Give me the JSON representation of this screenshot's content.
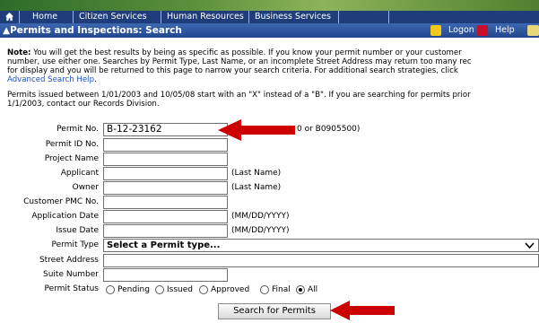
{
  "nav": {
    "items": [
      {
        "label": "Home"
      },
      {
        "label": "Citizen Services"
      },
      {
        "label": "Human Resources"
      },
      {
        "label": "Business Services"
      }
    ]
  },
  "titlebar": {
    "title": "▲Permits and Inspections: Search",
    "logon": "Logon",
    "help": "Help"
  },
  "note": {
    "bold": "Note:",
    "line1": " You will get the best results by being as specific as possible. If you know your permit number or your customer",
    "line2": "number, use either one. Searches by Permit Type, Last Name, or an incomplete Street Address may return too many rec",
    "line3": "for display and you will be returned to this page to narrow your search criteria. For additional search strategies, click",
    "link": "Advanced Search Help",
    "link_tail": "."
  },
  "permits_info": {
    "line1": "Permits issued between 1/01/2003 and 10/05/08 start with an \"X\" instead of a \"B\". If you are searching for permits prior",
    "line2": "1/1/2003, contact our Records Division."
  },
  "form": {
    "permit_no_label": "Permit No.",
    "permit_no_value": "B-12-23162",
    "permit_no_hint_start": "(e",
    "permit_no_hint_end": "0 or B0905500)",
    "permit_id_label": "Permit ID No.",
    "project_name_label": "Project Name",
    "applicant_label": "Applicant",
    "applicant_hint": "(Last Name)",
    "owner_label": "Owner",
    "owner_hint": "(Last Name)",
    "customer_pmc_label": "Customer PMC No.",
    "application_date_label": "Application Date",
    "application_date_hint": "(MM/DD/YYYY)",
    "issue_date_label": "Issue Date",
    "issue_date_hint": "(MM/DD/YYYY)",
    "permit_type_label": "Permit Type",
    "permit_type_value": "Select a Permit type...",
    "street_address_label": "Street Address",
    "suite_number_label": "Suite Number",
    "permit_status_label": "Permit Status",
    "status_options": [
      "Pending",
      "Issued",
      "Approved",
      "Final",
      "All"
    ],
    "selected_status": "All",
    "submit_label": "Search for Permits"
  },
  "colors": {
    "nav_bg": "#1f3d7a",
    "title_bg": "#2d559e",
    "arrow": "#cc0000",
    "link": "#1a4fc6"
  },
  "icons": [
    "home-icon",
    "lock-icon",
    "help-icon",
    "mail-icon",
    "chevron-down-icon",
    "red-arrow-icon"
  ]
}
